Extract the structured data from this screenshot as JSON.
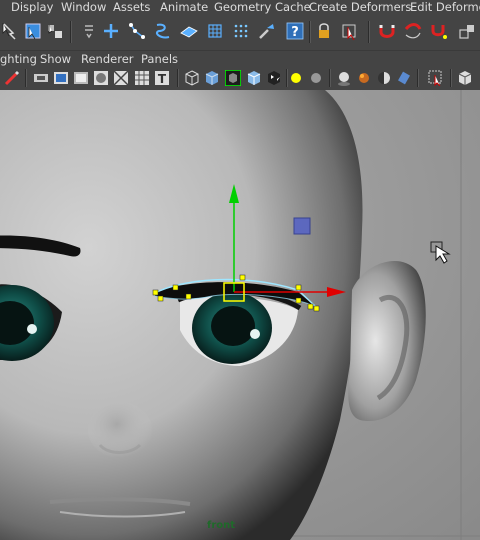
{
  "menubar": {
    "items": [
      "Display",
      "Window",
      "Assets",
      "Animate",
      "Geometry Cache",
      "Create Deformers",
      "Edit Deformers"
    ]
  },
  "toolbar": {
    "icons": [
      "lasso-select-icon",
      "paint-select-icon",
      "soft-select-icon",
      "channel-box-icon",
      "move-icon",
      "curve-points-icon",
      "curve-icon",
      "plane-icon",
      "lattice-icon",
      "dots-icon",
      "paint-icon",
      "help-icon",
      "lock-icon",
      "select-icon",
      "magnet-icon",
      "magnet-curve-icon",
      "magnet-point-icon",
      "snap-icon"
    ],
    "help_glyph": "?"
  },
  "panel_menu": {
    "items": [
      "ghting",
      "Show",
      "Renderer",
      "Panels"
    ]
  },
  "panel_toolbar": {
    "icons": [
      "pencil-icon",
      "camera-icon",
      "film-icon",
      "render-icon",
      "sphere-icon",
      "grid-icon",
      "text-icon",
      "wireframe-icon",
      "cube-icon",
      "cube-outline-icon",
      "box-icon",
      "checker-icon",
      "light-icon",
      "shade-icon",
      "sphere-shade-icon",
      "half-shade-icon",
      "cylinder-icon",
      "select-tool-icon",
      "view-cube-icon"
    ],
    "text_glyph": "T"
  },
  "viewport": {
    "camera_label": "front",
    "colors": {
      "manip_y": "#00d000",
      "manip_x": "#e00000",
      "manip_z": "#4a58c8",
      "cv": "#ffff00",
      "curve": "#9fe6ff"
    }
  }
}
